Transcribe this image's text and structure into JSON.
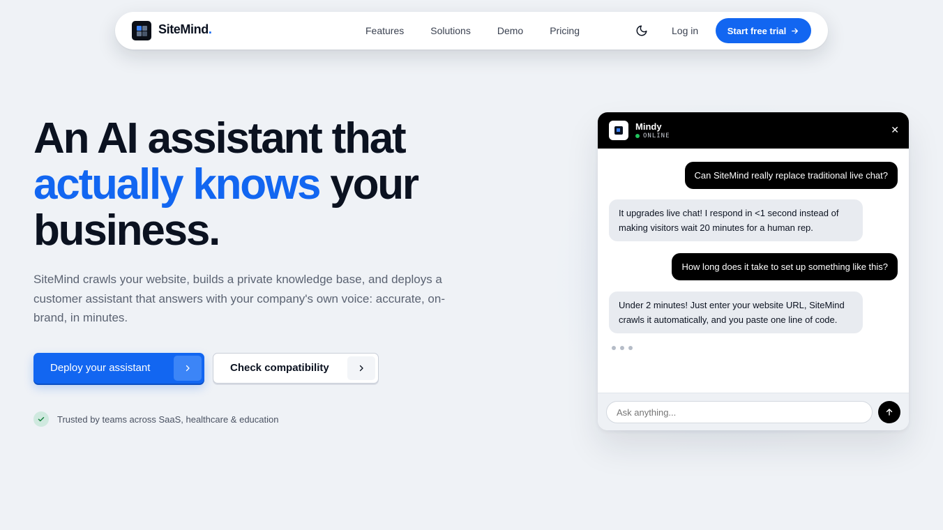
{
  "nav": {
    "brand": "SiteMind",
    "brand_dot": ".",
    "links": [
      "Features",
      "Solutions",
      "Demo",
      "Pricing"
    ],
    "theme_icon": "moon-icon",
    "login": "Log in",
    "cta": "Start free trial",
    "cta_icon": "arrow-right-icon"
  },
  "hero": {
    "title_line1": "An AI assistant that",
    "title_accent": "actually knows",
    "title_line2_rest": " your",
    "title_line3": "business.",
    "subtitle": "SiteMind crawls your website, builds a private knowledge base, and deploys a customer assistant that answers with your company's own voice: accurate, on-brand, in minutes.",
    "primary_button": "Deploy your assistant",
    "secondary_button": "Check compatibility",
    "trusted": "Trusted by teams across SaaS, healthcare & education"
  },
  "chat": {
    "bot_name": "Mindy",
    "status": "ONLINE",
    "messages": [
      {
        "from": "user",
        "text": "Can SiteMind really replace traditional live chat?"
      },
      {
        "from": "bot",
        "text": "It upgrades live chat! I respond in <1 second instead of making visitors wait 20 minutes for a human rep."
      },
      {
        "from": "user",
        "text": "How long does it take to set up something like this?"
      },
      {
        "from": "bot",
        "text": "Under 2 minutes! Just enter your website URL, SiteMind crawls it automatically, and you paste one line of code."
      }
    ],
    "input_placeholder": "Ask anything..."
  },
  "colors": {
    "accent": "#1266f1",
    "background": "#eff2f6",
    "online": "#22c55e"
  }
}
